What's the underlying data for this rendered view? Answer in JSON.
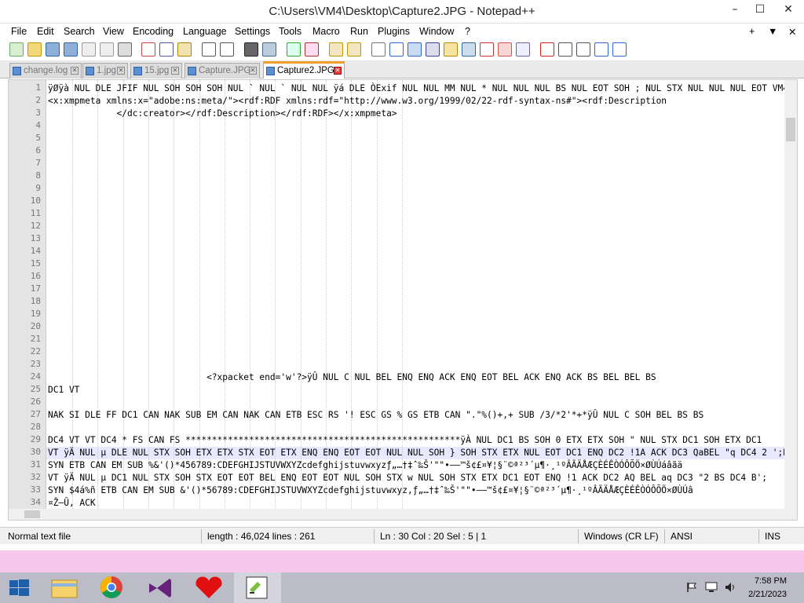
{
  "window": {
    "title": "C:\\Users\\VM4\\Desktop\\Capture2.JPG - Notepad++",
    "min": "–",
    "max": "☐",
    "close": "✕"
  },
  "menu": {
    "items": [
      "File",
      "Edit",
      "Search",
      "View",
      "Encoding",
      "Language",
      "Settings",
      "Tools",
      "Macro",
      "Run",
      "Plugins",
      "Window",
      "?"
    ],
    "right": [
      "+",
      "▼",
      "✕"
    ]
  },
  "tabs": [
    {
      "label": "change.log",
      "active": false
    },
    {
      "label": "1.jpg",
      "active": false
    },
    {
      "label": "15.jpg",
      "active": false
    },
    {
      "label": "Capture.JPG",
      "active": false
    },
    {
      "label": "Capture2.JPG",
      "active": true
    }
  ],
  "editor": {
    "line_numbers": [
      "1",
      "2",
      "3",
      "4",
      "5",
      "6",
      "7",
      "8",
      "9",
      "10",
      "11",
      "12",
      "13",
      "14",
      "15",
      "16",
      "17",
      "18",
      "19",
      "20",
      "21",
      "22",
      "23",
      "24",
      "25",
      "26",
      "27",
      "28",
      "29",
      "30",
      "31",
      "32",
      "33",
      "34"
    ],
    "lines": [
      "ÿØÿà NUL DLE JFIF NUL SOH SOH SOH NUL ` NUL ` NUL NUL ÿá DLE ÒExif NUL NUL MM NUL * NUL NUL NUL BS NUL EOT SOH ; NUL STX NUL NUL NUL EOT VM4 NUL",
      "<x:xmpmeta xmlns:x=\"adobe:ns:meta/\"><rdf:RDF xmlns:rdf=\"http://www.w3.org/1999/02/22-rdf-syntax-ns#\"><rdf:Description",
      "             </dc:creator></rdf:Description></rdf:RDF></x:xmpmeta>",
      "",
      "",
      "",
      "",
      "",
      "",
      "",
      "",
      "",
      "",
      "",
      "",
      "",
      "",
      "",
      "",
      "",
      "",
      "",
      "",
      "                              <?xpacket end='w'?>ÿÛ NUL C NUL BEL ENQ ENQ ACK ENQ EOT BEL ACK ENQ ACK BS BEL BEL BS",
      "DC1 VT",
      "",
      "NAK SI DLE FF DC1 CAN NAK SUB EM CAN NAK CAN ETB ESC RS '! ESC GS % GS ETB CAN \".\"%()+,+ SUB /3/*2'*+*ÿÛ NUL C SOH BEL BS BS",
      "",
      "DC4 VT VT DC4 * FS CAN FS ****************************************************ÿÀ NUL DC1 BS SOH 0 ETX ETX SOH \" NUL STX DC1 SOH ETX DC1",
      "VT ÿÄ NUL μ DLE NUL STX SOH ETX ETX STX EOT ETX ENQ ENQ EOT EOT NUL NUL SOH } SOH STX ETX NUL EOT DC1 ENQ DC2 !1A ACK DC3 QaBEL \"q DC4 2 ';BS#",
      "SYN ETB CAN EM SUB %&'()*456789:CDEFGHIJSTUVWXYZcdefghijstuvwxyzƒ„…†‡ˆ‰Š'\"\"•–—™š¢£¤¥¦§¨©ª²³´µ¶·¸¹ºÂÃÄÅÆÇÈÉÊÒÓÔÕÖ×ØÙÚáâãä",
      "VT ÿÄ NUL μ DC1 NUL STX SOH STX EOT EOT BEL ENQ EOT EOT NUL SOH STX w NUL SOH STX ETX DC1 EOT ENQ !1 ACK DC2 AQ BEL aq DC3 \"2 BS DC4 B';",
      "SYN $4á%ñ ETB CAN EM SUB &'()*56789:CDEFGHIJSTUVWXYZcdefghijstuvwxyz,ƒ„…†‡ˆ‰Š'\"\"•–—™š¢£¤¥¦§¨©ª²³´µ¶·¸¹ºÂÃÄÅÆÇÈÉÊÒÓÔÕÖ×ØÙÚâ",
      "¤Ž–Û, ACK"
    ]
  },
  "status": {
    "type": "Normal text file",
    "length": "length : 46,024    lines : 261",
    "position": "Ln : 30    Col : 20    Sel : 5 | 1",
    "eol": "Windows (CR LF)",
    "encoding": "ANSI",
    "mode": "INS"
  },
  "taskbar": {
    "time": "7:58 PM",
    "date": "2/21/2023",
    "apps": [
      "start-button",
      "file-explorer",
      "chrome",
      "visual-studio",
      "heart-app",
      "notepad-plus-plus"
    ]
  },
  "colors": {
    "accent_tab": "#f0a030",
    "current_line": "#e8e8ff",
    "pink_band": "#f8c8ec"
  }
}
